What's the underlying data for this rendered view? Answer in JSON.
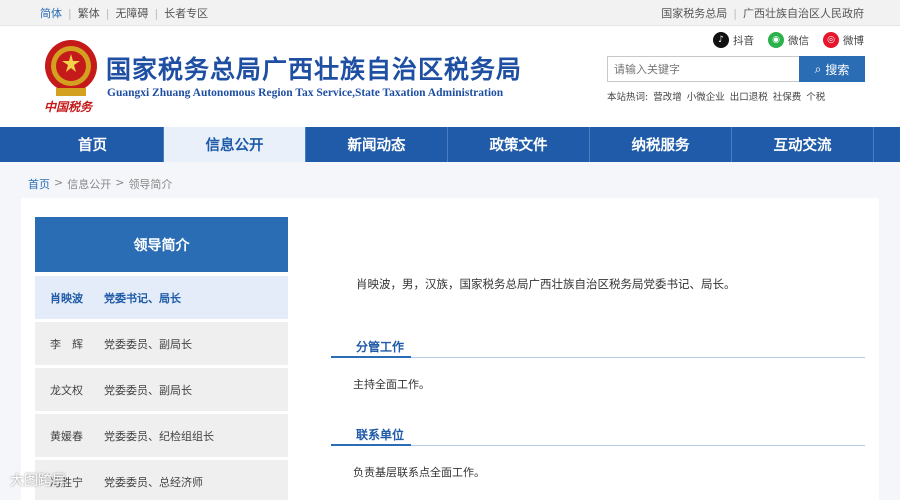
{
  "topbar": {
    "left": [
      "简体",
      "繁体",
      "无障碍",
      "长者专区"
    ],
    "right": [
      "国家税务总局",
      "广西壮族自治区人民政府"
    ]
  },
  "header": {
    "brand_sub": "中国税务",
    "title": "国家税务总局广西壮族自治区税务局",
    "title_en": "Guangxi Zhuang Autonomous Region Tax Service,State Taxation Administration",
    "social": [
      "抖音",
      "微信",
      "微博"
    ],
    "search_placeholder": "请输入关键字",
    "search_button": "搜索",
    "hot_label": "本站热词:",
    "hotwords": [
      "营改增",
      "小微企业",
      "出口退税",
      "社保费",
      "个税"
    ]
  },
  "nav": [
    "首页",
    "信息公开",
    "新闻动态",
    "政策文件",
    "纳税服务",
    "互动交流"
  ],
  "breadcrumb": [
    "首页",
    "信息公开",
    "领导简介"
  ],
  "sidebar": {
    "title": "领导简介",
    "items": [
      {
        "name": "肖映波",
        "role": "党委书记、局长"
      },
      {
        "name": "李　辉",
        "role": "党委委员、副局长"
      },
      {
        "name": "龙文权",
        "role": "党委委员、副局长"
      },
      {
        "name": "黄媛春",
        "role": "党委委员、纪检组组长"
      },
      {
        "name": "冯胜宁",
        "role": "党委委员、总经济师"
      }
    ]
  },
  "main": {
    "bio": "肖映波，男，汉族，国家税务总局广西壮族自治区税务局党委书记、局长。",
    "sections": [
      {
        "title": "分管工作",
        "text": "主持全面工作。"
      },
      {
        "title": "联系单位",
        "text": "负责基层联系点全面工作。"
      }
    ]
  },
  "watermark": "大图跨屏",
  "colors": {
    "primary": "#1f5ba8",
    "accent": "#2a6db5",
    "emblem_red": "#c41a1a"
  }
}
